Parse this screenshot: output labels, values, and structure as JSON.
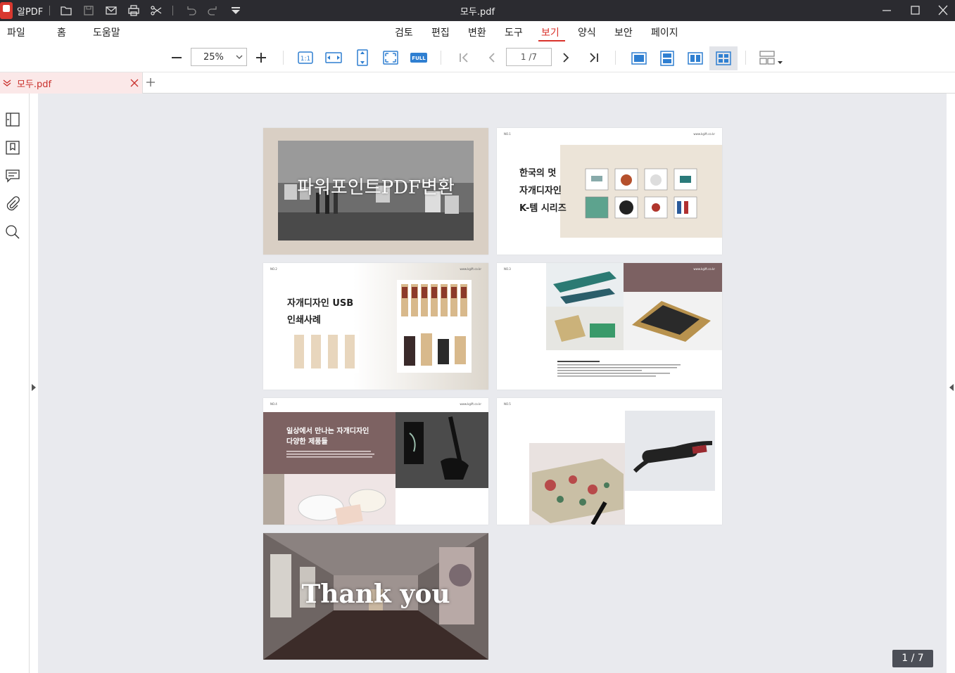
{
  "app": {
    "name": "알PDF",
    "window_title": "모두.pdf"
  },
  "menu": {
    "left": [
      "파일",
      "홈",
      "도움말"
    ],
    "main": [
      "검토",
      "편집",
      "변환",
      "도구",
      "보기",
      "양식",
      "보안",
      "페이지"
    ],
    "active": "보기"
  },
  "toolbar": {
    "zoom_value": "25%",
    "page_indicator": "1 /7",
    "fit_full_label": "FULL",
    "actual_size_label": "1:1"
  },
  "tab": {
    "name": "모두.pdf"
  },
  "pages": {
    "p1_title": "파워포인트PDF변환",
    "p2_no": "NO.1",
    "p2_url": "www.kgift.co.kr",
    "p2_line1": "한국의 멋",
    "p2_line2": "자개디자인",
    "p2_line3": "K-템 시리즈",
    "p3_no": "NO.2",
    "p3_url": "www.kgift.co.kr",
    "p3_line1": "자개디자인 USB",
    "p3_line2": "인쇄사례",
    "p4_no": "NO.3",
    "p4_url": "www.kgift.co.kr",
    "p5_no": "NO.4",
    "p5_url": "www.kgift.co.kr",
    "p5_line1": "일상에서 만나는 자개디자인",
    "p5_line2": "다양한 제품들",
    "p6_no": "NO.5",
    "p7_title": "Thank you"
  },
  "status": {
    "page_count": "1 / 7"
  },
  "colors": {
    "accent": "#d9322b",
    "titlebar": "#2b2b30",
    "canvas": "#e9eaee",
    "toolbar_blue": "#2f7fd1"
  }
}
